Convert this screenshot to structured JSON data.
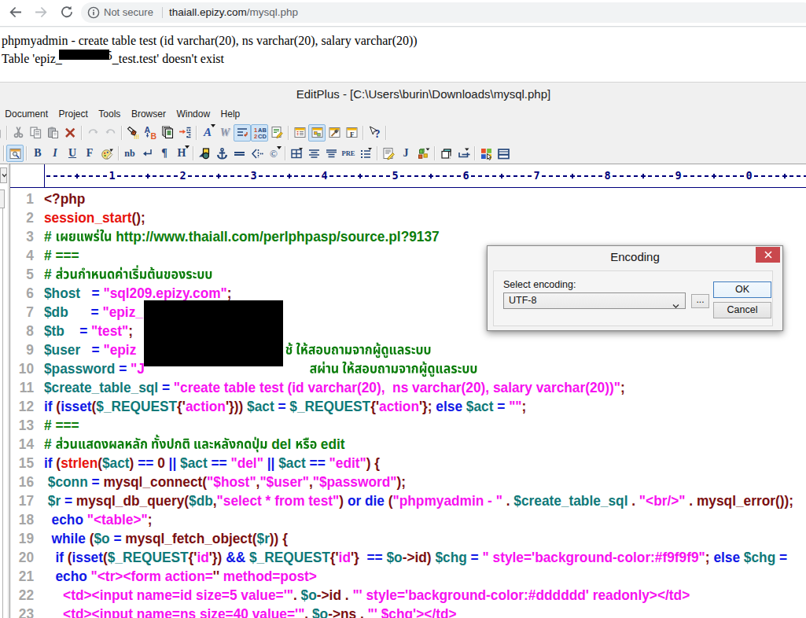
{
  "browser": {
    "security_text": "Not secure",
    "url_host": "thaiall.epizy.com",
    "url_path": "/mysql.php"
  },
  "page": {
    "line1": "phpmyadmin - create table test (id varchar(20), ns varchar(20), salary varchar(20))",
    "line2_prefix": "Table 'epiz_",
    "line2_suffix": "_test.test' doesn't exist",
    "line2_partial_char": "5"
  },
  "editor": {
    "title": "EditPlus - [C:\\Users\\burin\\Downloads\\mysql.php]",
    "menus": [
      "Document",
      "Project",
      "Tools",
      "Browser",
      "Window",
      "Help"
    ],
    "toolbar_main": [
      {
        "name": "new-document-icon",
        "partial": true
      },
      {
        "sep": true
      },
      {
        "name": "cut-icon"
      },
      {
        "name": "copy-icon"
      },
      {
        "name": "paste-icon"
      },
      {
        "name": "delete-icon"
      },
      {
        "sep": true
      },
      {
        "name": "undo-icon"
      },
      {
        "name": "redo-icon"
      },
      {
        "sep": true
      },
      {
        "name": "find-icon"
      },
      {
        "name": "replace-icon"
      },
      {
        "name": "find-in-files-icon"
      },
      {
        "name": "goto-line-icon"
      },
      {
        "sep": true
      },
      {
        "name": "font-icon"
      },
      {
        "name": "wrap-to-window-icon"
      },
      {
        "name": "word-wrap-icon",
        "pressed": true
      },
      {
        "name": "line-numbers-icon",
        "pressed": true
      },
      {
        "name": "document-properties-icon"
      },
      {
        "sep": true
      },
      {
        "name": "document-list-icon"
      },
      {
        "name": "cliptext-window-icon",
        "pressed": true
      },
      {
        "name": "tool-window-icon"
      },
      {
        "name": "function-list-icon"
      },
      {
        "sep": true
      },
      {
        "name": "context-help-icon"
      },
      {
        "sep": true
      }
    ],
    "toolbar_html": [
      {
        "grip": true
      },
      {
        "name": "browser-preview-icon",
        "pressed": true
      },
      {
        "sep": true
      },
      {
        "name": "bold-icon"
      },
      {
        "name": "italic-icon"
      },
      {
        "name": "underline-icon"
      },
      {
        "name": "font-face-icon"
      },
      {
        "name": "text-color-icon"
      },
      {
        "sep": true
      },
      {
        "name": "nonbreaking-space-icon"
      },
      {
        "name": "line-break-icon"
      },
      {
        "name": "paragraph-icon"
      },
      {
        "name": "heading-icon"
      },
      {
        "sep": true
      },
      {
        "name": "image-icon"
      },
      {
        "name": "anchor-icon"
      },
      {
        "name": "horizontal-rule-icon"
      },
      {
        "name": "break-tag-icon"
      },
      {
        "name": "special-char-icon"
      },
      {
        "sep": true
      },
      {
        "name": "table-icon"
      },
      {
        "name": "align-center-icon"
      },
      {
        "name": "align-right-icon"
      },
      {
        "name": "pre-icon"
      },
      {
        "name": "list-icon"
      },
      {
        "sep": true
      },
      {
        "name": "script-icon"
      },
      {
        "name": "javascript-icon"
      },
      {
        "name": "object-icon"
      },
      {
        "sep": true
      },
      {
        "name": "copy-html-icon"
      },
      {
        "name": "tag-select-icon"
      },
      {
        "sep": true
      },
      {
        "name": "browser-window-icon"
      },
      {
        "name": "split-window-icon"
      }
    ],
    "ruler_columns": 110,
    "code_lines": [
      {
        "n": 1,
        "t": [
          [
            "m",
            "<?php"
          ]
        ]
      },
      {
        "n": 2,
        "t": [
          [
            "r",
            "session_start"
          ],
          [
            "m",
            "();"
          ]
        ]
      },
      {
        "n": 3,
        "t": [
          [
            "c",
            "# "
          ],
          [
            "th-c",
            "เผยแพร่ใน"
          ],
          [
            "c",
            " http://www.thaiall.com/perlphpasp/source.pl?9137"
          ]
        ]
      },
      {
        "n": 4,
        "t": [
          [
            "c",
            "# ==="
          ]
        ]
      },
      {
        "n": 5,
        "t": [
          [
            "c",
            "# "
          ],
          [
            "th-c",
            "ส่วนกำหนดค่าเริ่มต้นของระบบ"
          ]
        ]
      },
      {
        "n": 6,
        "t": [
          [
            "v",
            "$host"
          ],
          [
            "m",
            "   "
          ],
          [
            "k",
            "= "
          ],
          [
            "s",
            "\"sql209.epizy.com\""
          ],
          [
            "m",
            ";"
          ]
        ]
      },
      {
        "n": 7,
        "t": [
          [
            "v",
            "$db"
          ],
          [
            "m",
            "      "
          ],
          [
            "k",
            "= "
          ],
          [
            "s",
            "\"epiz_"
          ]
        ]
      },
      {
        "n": 8,
        "t": [
          [
            "v",
            "$tb"
          ],
          [
            "m",
            "    "
          ],
          [
            "k",
            "= "
          ],
          [
            "s",
            "\"test\""
          ],
          [
            "m",
            ";"
          ]
        ]
      },
      {
        "n": 9,
        "t": [
          [
            "v",
            "$user"
          ],
          [
            "m",
            "   "
          ],
          [
            "k",
            "= "
          ],
          [
            "s",
            "\"epiz"
          ],
          [
            "pad",
            "208"
          ],
          [
            "th-c",
            "ช้ ให้สอบถามจากผู้ดูแลระบบ"
          ]
        ]
      },
      {
        "n": 10,
        "t": [
          [
            "v",
            "$password"
          ],
          [
            "m",
            " "
          ],
          [
            "k",
            "= "
          ],
          [
            "s",
            "\"J"
          ],
          [
            "pad",
            "230"
          ],
          [
            "th-c",
            "สผ่าน ให้สอบถามจากผู้ดูแลระบบ"
          ]
        ]
      },
      {
        "n": 11,
        "t": [
          [
            "v",
            "$create_table_sql"
          ],
          [
            "m",
            " "
          ],
          [
            "k",
            "= "
          ],
          [
            "s",
            "\"create table test (id varchar(20),  ns varchar(20), salary varchar(20))\""
          ],
          [
            "m",
            ";"
          ]
        ]
      },
      {
        "n": 12,
        "t": [
          [
            "k",
            "if "
          ],
          [
            "m",
            "("
          ],
          [
            "k",
            "isset"
          ],
          [
            "m",
            "("
          ],
          [
            "v",
            "$_REQUEST"
          ],
          [
            "m",
            "{'"
          ],
          [
            "s",
            "action"
          ],
          [
            "m",
            "'})) "
          ],
          [
            "v",
            "$act"
          ],
          [
            "k",
            " = "
          ],
          [
            "v",
            "$_REQUEST"
          ],
          [
            "m",
            "{'"
          ],
          [
            "s",
            "action"
          ],
          [
            "m",
            "'}; "
          ],
          [
            "k",
            "else "
          ],
          [
            "v",
            "$act"
          ],
          [
            "k",
            " = "
          ],
          [
            "s",
            "\"\""
          ],
          [
            "m",
            ";"
          ]
        ]
      },
      {
        "n": 13,
        "t": [
          [
            "c",
            "# ==="
          ]
        ]
      },
      {
        "n": 14,
        "t": [
          [
            "c",
            "# "
          ],
          [
            "th-c",
            "ส่วนแสดงผลหลัก ทั้งปกติ และหลังกดปุ่ม"
          ],
          [
            "c",
            " del "
          ],
          [
            "th-c",
            "หรือ"
          ],
          [
            "c",
            " edit"
          ]
        ]
      },
      {
        "n": 15,
        "t": [
          [
            "k",
            "if "
          ],
          [
            "m",
            "("
          ],
          [
            "r",
            "strlen"
          ],
          [
            "m",
            "("
          ],
          [
            "v",
            "$act"
          ],
          [
            "m",
            ") "
          ],
          [
            "k",
            "== "
          ],
          [
            "m",
            "0 "
          ],
          [
            "k",
            "|| "
          ],
          [
            "v",
            "$act"
          ],
          [
            "k",
            " == "
          ],
          [
            "s",
            "\"del\""
          ],
          [
            "k",
            " || "
          ],
          [
            "v",
            "$act"
          ],
          [
            "k",
            " == "
          ],
          [
            "s",
            "\"edit\""
          ],
          [
            "m",
            ") {"
          ]
        ]
      },
      {
        "n": 16,
        "t": [
          [
            "m",
            " "
          ],
          [
            "v",
            "$conn"
          ],
          [
            "k",
            " = "
          ],
          [
            "m",
            "mysql_connect("
          ],
          [
            "s",
            "\"$host\""
          ],
          [
            "m",
            ","
          ],
          [
            "s",
            "\"$user\""
          ],
          [
            "m",
            ","
          ],
          [
            "s",
            "\"$password\""
          ],
          [
            "m",
            ");"
          ]
        ]
      },
      {
        "n": 17,
        "t": [
          [
            "m",
            " "
          ],
          [
            "v",
            "$r"
          ],
          [
            "k",
            " = "
          ],
          [
            "m",
            "mysql_db_query("
          ],
          [
            "v",
            "$db"
          ],
          [
            "m",
            ","
          ],
          [
            "s",
            "\"select * from test\""
          ],
          [
            "m",
            ") "
          ],
          [
            "k",
            "or die "
          ],
          [
            "m",
            "("
          ],
          [
            "s",
            "\"phpmyadmin - \""
          ],
          [
            "m",
            " . "
          ],
          [
            "v",
            "$create_table_sql"
          ],
          [
            "m",
            " . "
          ],
          [
            "s",
            "\"<br/>\""
          ],
          [
            "m",
            " . mysql_error());"
          ]
        ]
      },
      {
        "n": 18,
        "t": [
          [
            "m",
            "  "
          ],
          [
            "k",
            "echo "
          ],
          [
            "s",
            "\"<table>\""
          ],
          [
            "m",
            ";"
          ]
        ]
      },
      {
        "n": 19,
        "t": [
          [
            "m",
            "  "
          ],
          [
            "k",
            "while "
          ],
          [
            "m",
            "("
          ],
          [
            "v",
            "$o"
          ],
          [
            "k",
            " = "
          ],
          [
            "m",
            "mysql_fetch_object("
          ],
          [
            "v",
            "$r"
          ],
          [
            "m",
            ")) {"
          ]
        ]
      },
      {
        "n": 20,
        "t": [
          [
            "m",
            "   "
          ],
          [
            "k",
            "if "
          ],
          [
            "m",
            "("
          ],
          [
            "k",
            "isset"
          ],
          [
            "m",
            "("
          ],
          [
            "v",
            "$_REQUEST"
          ],
          [
            "m",
            "{'"
          ],
          [
            "s",
            "id"
          ],
          [
            "m",
            "'}) "
          ],
          [
            "k",
            "&& "
          ],
          [
            "v",
            "$_REQUEST"
          ],
          [
            "m",
            "{'"
          ],
          [
            "s",
            "id"
          ],
          [
            "m",
            "'}  "
          ],
          [
            "k",
            "== "
          ],
          [
            "v",
            "$o"
          ],
          [
            "m",
            "->id) "
          ],
          [
            "v",
            "$chg"
          ],
          [
            "k",
            " = "
          ],
          [
            "s",
            "\" style='background-color:#f9f9f9\""
          ],
          [
            "m",
            "; "
          ],
          [
            "k",
            "else "
          ],
          [
            "v",
            "$chg"
          ],
          [
            "k",
            " ="
          ]
        ]
      },
      {
        "n": 21,
        "t": [
          [
            "m",
            "   "
          ],
          [
            "k",
            "echo "
          ],
          [
            "s",
            "\"<tr><form action="
          ],
          [
            "m",
            "''"
          ],
          [
            "s",
            " method=post>"
          ]
        ]
      },
      {
        "n": 22,
        "t": [
          [
            "m",
            "     "
          ],
          [
            "s",
            "<td><input name=id size=5 value='\""
          ],
          [
            "m",
            ". "
          ],
          [
            "v",
            "$o"
          ],
          [
            "m",
            "->id . "
          ],
          [
            "s",
            "\"' style='background-color:#dddddd' readonly></td>"
          ]
        ]
      },
      {
        "n": 23,
        "t": [
          [
            "m",
            "     "
          ],
          [
            "s",
            "<td><input name=ns size=40 value='\""
          ],
          [
            "m",
            ". "
          ],
          [
            "v",
            "$o"
          ],
          [
            "m",
            "->ns . "
          ],
          [
            "s",
            "\"' $chg'></td>"
          ]
        ]
      }
    ]
  },
  "dialog": {
    "title": "Encoding",
    "label": "Select encoding:",
    "combo_value": "UTF-8",
    "browse_label": "...",
    "ok_label": "OK",
    "cancel_label": "Cancel"
  },
  "colors": {
    "syntax_default": "#7b0f11",
    "syntax_function": "#e8130e",
    "syntax_keyword": "#1019e6",
    "syntax_variable": "#0f7979",
    "syntax_string": "#f711f0",
    "syntax_comment": "#0b7d0b",
    "ruler": "#00007b",
    "close_button": "#c9484d",
    "omnibox_bg": "#f1f3f4"
  }
}
